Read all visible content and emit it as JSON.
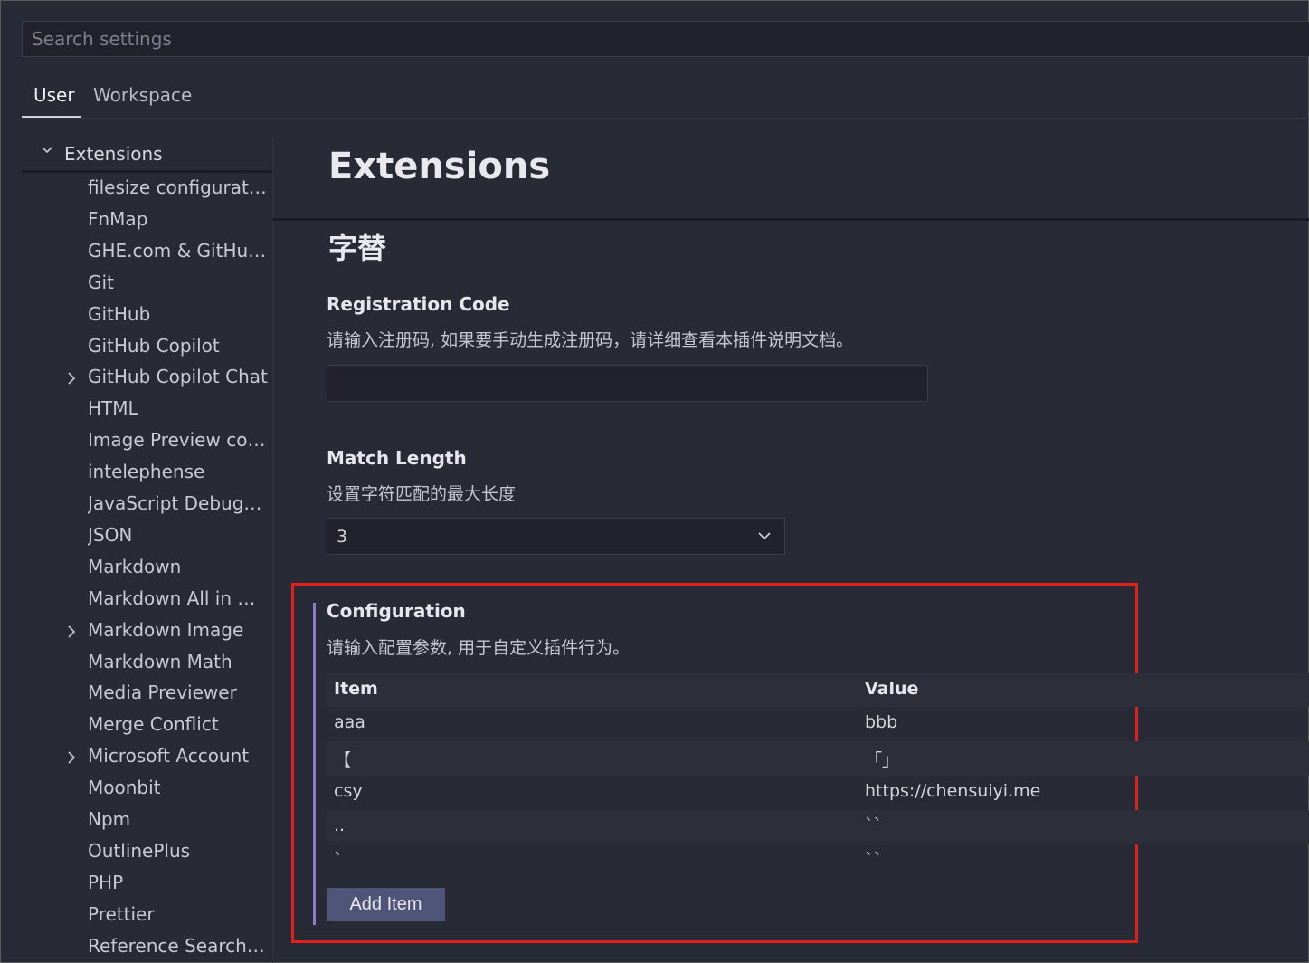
{
  "search": {
    "placeholder": "Search settings"
  },
  "tabs": [
    {
      "label": "User",
      "active": true
    },
    {
      "label": "Workspace",
      "active": false
    }
  ],
  "sidebar": {
    "header": "Extensions",
    "items": [
      {
        "label": "filesize configuration",
        "expandable": false
      },
      {
        "label": "FnMap",
        "expandable": false
      },
      {
        "label": "GHE.com & GitHub ...",
        "expandable": false
      },
      {
        "label": "Git",
        "expandable": false
      },
      {
        "label": "GitHub",
        "expandable": false
      },
      {
        "label": "GitHub Copilot",
        "expandable": false
      },
      {
        "label": "GitHub Copilot Chat",
        "expandable": true
      },
      {
        "label": "HTML",
        "expandable": false
      },
      {
        "label": "Image Preview confi...",
        "expandable": false
      },
      {
        "label": "intelephense",
        "expandable": false
      },
      {
        "label": "JavaScript Debugger",
        "expandable": false
      },
      {
        "label": "JSON",
        "expandable": false
      },
      {
        "label": "Markdown",
        "expandable": false
      },
      {
        "label": "Markdown All in One",
        "expandable": false
      },
      {
        "label": "Markdown Image",
        "expandable": true
      },
      {
        "label": "Markdown Math",
        "expandable": false
      },
      {
        "label": "Media Previewer",
        "expandable": false
      },
      {
        "label": "Merge Conflict",
        "expandable": false
      },
      {
        "label": "Microsoft Account",
        "expandable": true
      },
      {
        "label": "Moonbit",
        "expandable": false
      },
      {
        "label": "Npm",
        "expandable": false
      },
      {
        "label": "OutlinePlus",
        "expandable": false
      },
      {
        "label": "PHP",
        "expandable": false
      },
      {
        "label": "Prettier",
        "expandable": false
      },
      {
        "label": "Reference Search Vi...",
        "expandable": false
      }
    ]
  },
  "main": {
    "title": "Extensions",
    "section_title": "字替",
    "registration": {
      "title": "Registration Code",
      "description": "请输入注册码, 如果要手动生成注册码，请详细查看本插件说明文档。",
      "value": ""
    },
    "match_length": {
      "title": "Match Length",
      "description": "设置字符匹配的最大长度",
      "value": "3"
    },
    "configuration": {
      "title": "Configuration",
      "description": "请输入配置参数, 用于自定义插件行为。",
      "columns": {
        "item": "Item",
        "value": "Value"
      },
      "rows": [
        {
          "item": "aaa",
          "value": "bbb"
        },
        {
          "item": "【",
          "value": "「」"
        },
        {
          "item": "csy",
          "value": "https://chensuiyi.me"
        },
        {
          "item": "..",
          "value": "``"
        },
        {
          "item": "`",
          "value": "``"
        }
      ],
      "add_label": "Add Item"
    }
  },
  "colors": {
    "background": "#282a36",
    "highlight_border": "#e0201c",
    "modified_indicator": "#8a7bcf",
    "button": "#4f5578"
  }
}
